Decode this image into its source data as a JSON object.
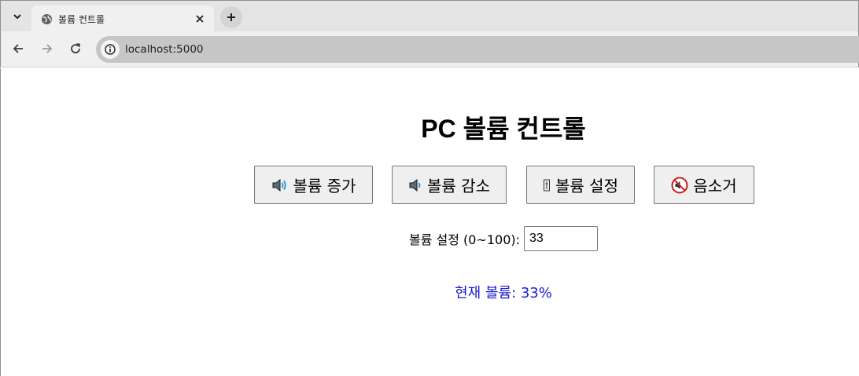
{
  "browser": {
    "tab_title": "볼륨 컨트롤",
    "url": "localhost:5000",
    "icons": {
      "tab_menu": "chevron-down-icon",
      "favicon": "globe-icon",
      "close": "close-icon",
      "new_tab": "plus-icon",
      "back": "back-arrow-icon",
      "forward": "forward-arrow-icon",
      "reload": "reload-icon",
      "site_info": "info-icon"
    }
  },
  "page": {
    "title": "PC 볼륨 컨트롤",
    "buttons": [
      {
        "label": "볼륨 증가",
        "icon": "speaker-loud-icon"
      },
      {
        "label": "볼륨 감소",
        "icon": "speaker-low-icon"
      },
      {
        "label": "볼륨 설정",
        "icon": "tuning-icon"
      },
      {
        "label": "음소거",
        "icon": "mute-icon"
      }
    ],
    "setting_label": "볼륨 설정 (0~100):",
    "setting_value": "33",
    "status_text": "현재 볼륨: 33%"
  },
  "colors": {
    "status_text": "#1a1ad6",
    "button_bg": "#efefef",
    "tabbar_bg": "#e4e4e4",
    "omnibox_bg": "#c6c6c6"
  }
}
